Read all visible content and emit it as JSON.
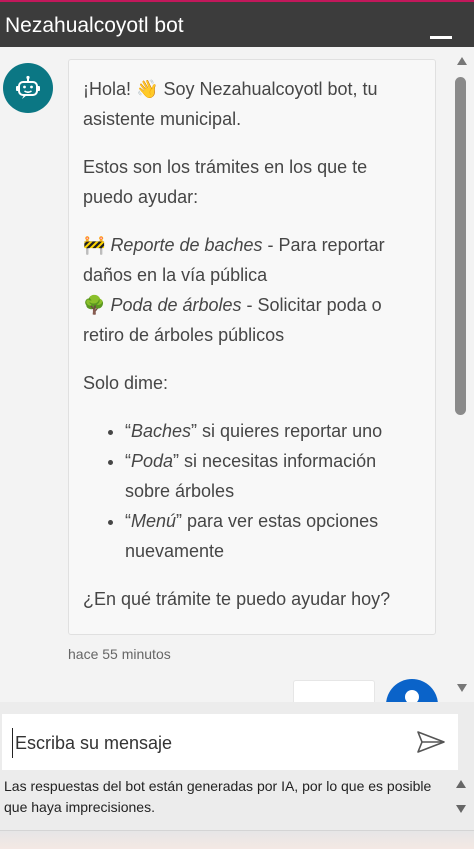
{
  "header": {
    "title": "Nezahualcoyotl bot"
  },
  "bot_message": {
    "greeting_text": "¡Hola! ",
    "greeting_emoji": "👋",
    "greeting_rest": " Soy Nezahualcoyotl bot, tu asistente municipal.",
    "intro": "Estos son los trámites en los que te puedo ayudar:",
    "services": [
      {
        "emoji": "🚧",
        "name": "Reporte de baches",
        "description": " - Para reportar daños en la vía pública"
      },
      {
        "emoji": "🌳",
        "name": "Poda de árboles",
        "description": " - Solicitar poda o retiro de árboles públicos"
      }
    ],
    "prompt": "Solo dime:",
    "options": [
      {
        "open": "“",
        "keyword": "Baches",
        "close": "”",
        "text": " si quieres reportar uno"
      },
      {
        "open": "“",
        "keyword": "Poda",
        "close": "”",
        "text": " si necesitas información sobre árboles"
      },
      {
        "open": "“",
        "keyword": "Menú",
        "close": "”",
        "text": " para ver estas opciones nuevamente"
      }
    ],
    "question": "¿En qué trámite te puedo ayudar hoy?",
    "timestamp": "hace 55 minutos"
  },
  "composer": {
    "placeholder": "Escriba su mensaje",
    "disclaimer": "Las respuestas del bot están generadas por IA, por lo que es posible que haya imprecisiones."
  },
  "colors": {
    "header": "#3c3c3c",
    "bot_avatar": "#0b7784",
    "user_avatar": "#0a63c9"
  },
  "icons": [
    "bot-icon",
    "minimize-icon",
    "send-icon",
    "user-icon"
  ]
}
